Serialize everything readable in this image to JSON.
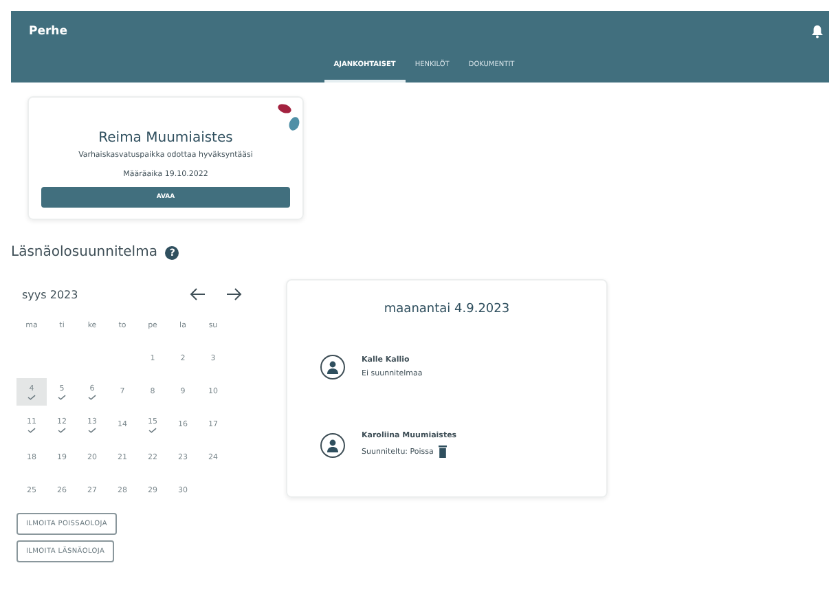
{
  "header": {
    "title": "Perhe"
  },
  "tabs": [
    {
      "label": "AJANKOHTAISET",
      "selected": true
    },
    {
      "label": "HENKILÖT",
      "selected": false
    },
    {
      "label": "DOKUMENTIT",
      "selected": false
    }
  ],
  "notice": {
    "name": "Reima Muumiaistes",
    "message": "Varhaiskasvatuspaikka odottaa hyväksyntääsi",
    "deadline": "Määräaika 19.10.2022",
    "button": "AVAA"
  },
  "section_title": "Läsnäolosuunnitelma",
  "help_icon": "?",
  "calendar": {
    "month": "syys 2023",
    "weekdays": [
      "ma",
      "ti",
      "ke",
      "to",
      "pe",
      "la",
      "su"
    ],
    "weeks": [
      [
        {
          "day": "1",
          "checked": false,
          "selected": false
        },
        {
          "day": "2",
          "checked": false,
          "selected": false
        },
        {
          "day": "3",
          "checked": false,
          "selected": false
        }
      ],
      [
        {
          "day": "4",
          "checked": true,
          "selected": true
        },
        {
          "day": "5",
          "checked": true,
          "selected": false
        },
        {
          "day": "6",
          "checked": true,
          "selected": false
        },
        {
          "day": "7",
          "checked": false,
          "selected": false
        },
        {
          "day": "8",
          "checked": false,
          "selected": false
        },
        {
          "day": "9",
          "checked": false,
          "selected": false
        },
        {
          "day": "10",
          "checked": false,
          "selected": false
        }
      ],
      [
        {
          "day": "11",
          "checked": true,
          "selected": false
        },
        {
          "day": "12",
          "checked": true,
          "selected": false
        },
        {
          "day": "13",
          "checked": true,
          "selected": false
        },
        {
          "day": "14",
          "checked": false,
          "selected": false
        },
        {
          "day": "15",
          "checked": true,
          "selected": false
        },
        {
          "day": "16",
          "checked": false,
          "selected": false
        },
        {
          "day": "17",
          "checked": false,
          "selected": false
        }
      ],
      [
        {
          "day": "18",
          "checked": false,
          "selected": false
        },
        {
          "day": "19",
          "checked": false,
          "selected": false
        },
        {
          "day": "20",
          "checked": false,
          "selected": false
        },
        {
          "day": "21",
          "checked": false,
          "selected": false
        },
        {
          "day": "22",
          "checked": false,
          "selected": false
        },
        {
          "day": "23",
          "checked": false,
          "selected": false
        },
        {
          "day": "24",
          "checked": false,
          "selected": false
        }
      ],
      [
        {
          "day": "25",
          "checked": false,
          "selected": false
        },
        {
          "day": "26",
          "checked": false,
          "selected": false
        },
        {
          "day": "27",
          "checked": false,
          "selected": false
        },
        {
          "day": "28",
          "checked": false,
          "selected": false
        },
        {
          "day": "29",
          "checked": false,
          "selected": false
        },
        {
          "day": "30",
          "checked": false,
          "selected": false
        }
      ]
    ]
  },
  "actions": [
    "ILMOITA POISSAOLOJA",
    "ILMOITA LÄSNÄOLOJA"
  ],
  "day_detail": {
    "date": "maanantai 4.9.2023",
    "people": [
      {
        "name": "Kalle Kallio",
        "status": "Ei suunnitelmaa",
        "absent": false
      },
      {
        "name": "Karoliina Muumiaistes",
        "status": "Suunniteltu: Poissa",
        "absent": true
      }
    ]
  }
}
